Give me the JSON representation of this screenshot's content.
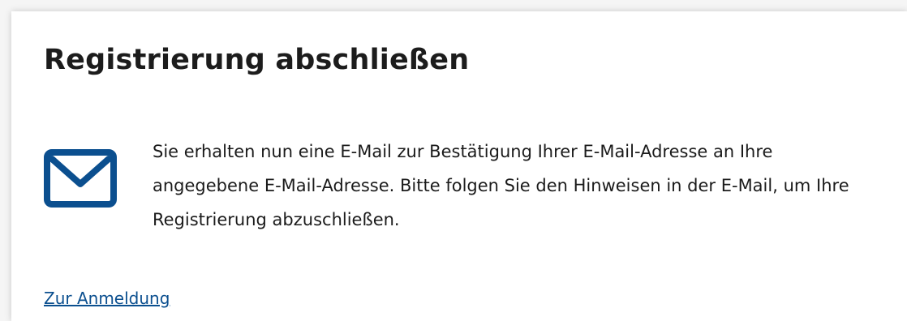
{
  "page": {
    "title": "Registrierung abschließen",
    "message": "Sie erhalten nun eine E-Mail zur Bestätigung Ihrer E-Mail-Adresse an Ihre angegebene E-Mail-Adresse. Bitte folgen Sie den Hinweisen in der E-Mail, um Ihre Registrierung abzuschließen.",
    "icon": "envelope-icon",
    "link_label": "Zur Anmeldung"
  },
  "colors": {
    "icon": "#0b4f8f",
    "link": "#0b4f8f",
    "title": "#1c1c1c",
    "text": "#1b1b1b",
    "page_background": "#f5f5f5",
    "card_background": "#ffffff"
  }
}
